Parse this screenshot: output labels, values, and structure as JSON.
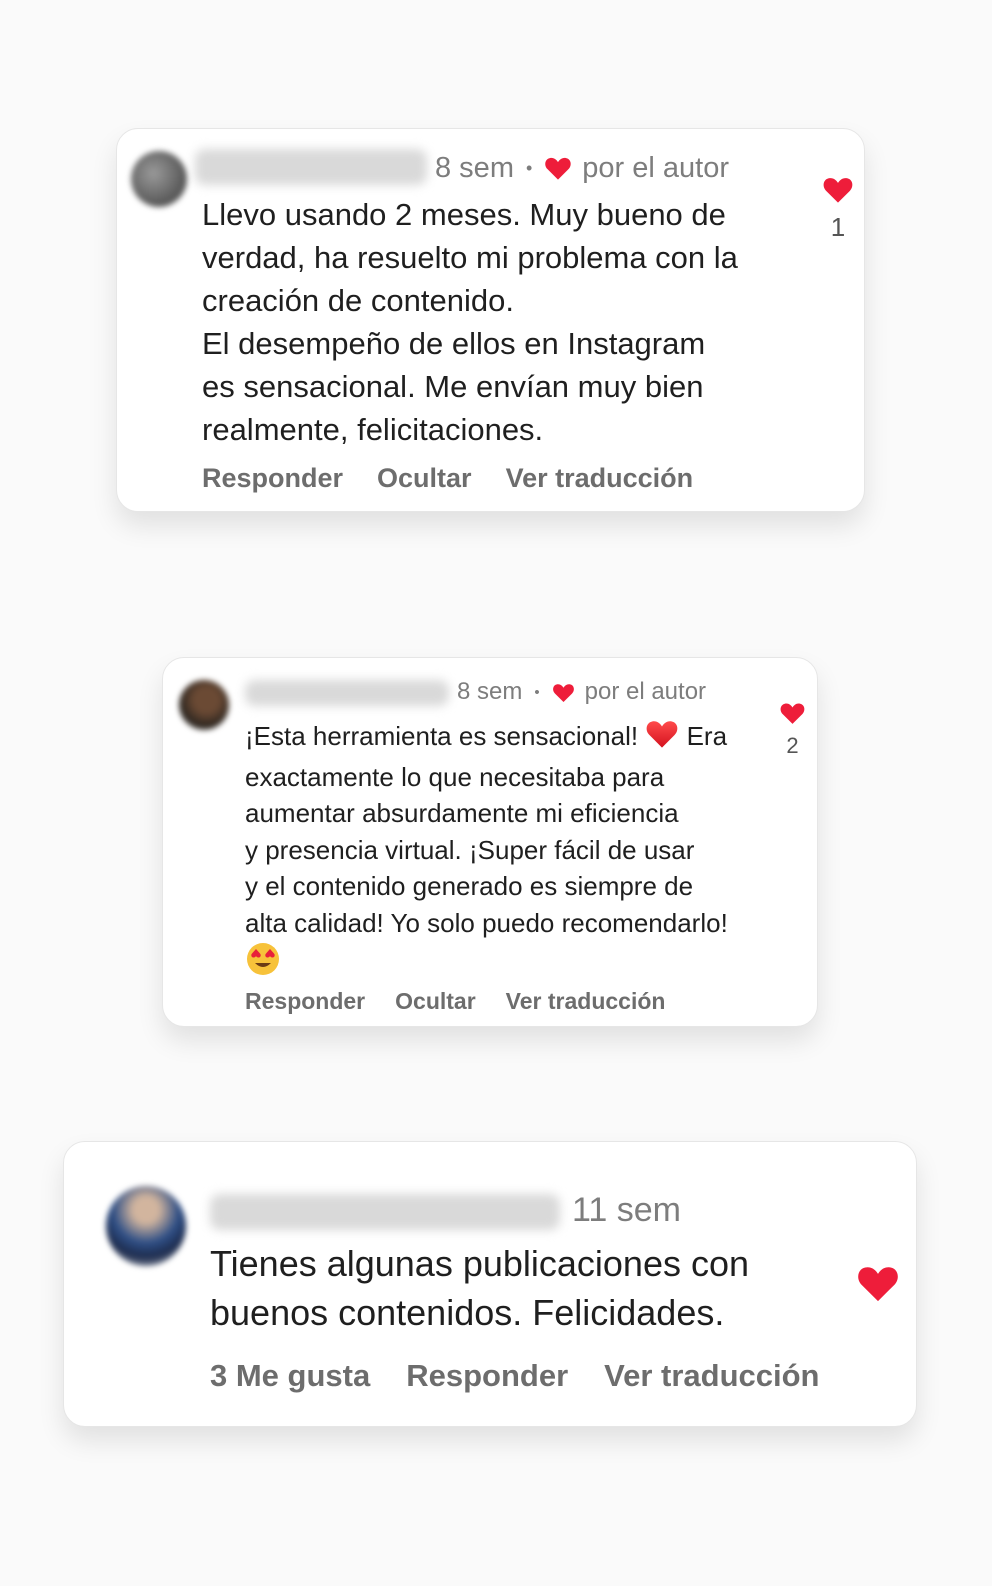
{
  "colors": {
    "heart": "#ee1d3a",
    "meta": "#7d7d7d",
    "actions": "#6d6d6d",
    "text": "#1f1f1f"
  },
  "comments": [
    {
      "time": "8 sem",
      "separator": "•",
      "liked_by": "por el autor",
      "lines": [
        "Llevo usando 2 meses. Muy bueno de",
        "verdad, ha resuelto mi problema con la",
        "creación de contenido.",
        "El desempeño de ellos en Instagram",
        "es sensacional. Me envían muy bien",
        "realmente, felicitaciones."
      ],
      "actions": [
        "Responder",
        "Ocultar",
        "Ver traducción"
      ],
      "like_count": "1"
    },
    {
      "time": "8 sem",
      "separator": "•",
      "liked_by": "por el autor",
      "line1_a": "¡Esta herramienta es sensacional!",
      "line1_b": "Era",
      "lines": [
        "exactamente lo que necesitaba para",
        "aumentar absurdamente mi eficiencia",
        "y presencia virtual. ¡Super fácil de usar",
        "y el contenido generado es siempre de",
        "alta calidad! Yo solo puedo recomendarlo!"
      ],
      "emojis": [
        "red-heart-emoji",
        "heart-eyes-emoji"
      ],
      "actions": [
        "Responder",
        "Ocultar",
        "Ver traducción"
      ],
      "like_count": "2"
    },
    {
      "time": "11 sem",
      "lines": [
        "Tienes algunas publicaciones con",
        "buenos contenidos. Felicidades."
      ],
      "actions": [
        "3 Me gusta",
        "Responder",
        "Ver traducción"
      ]
    }
  ]
}
